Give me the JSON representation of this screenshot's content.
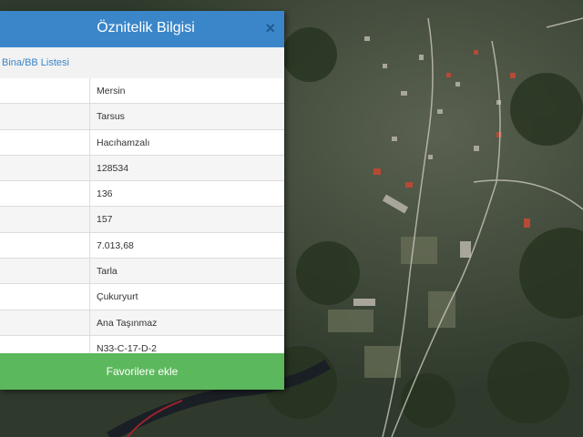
{
  "dialog": {
    "title": "Öznitelik Bilgisi",
    "close_icon": "×",
    "subheader_link": "Bina/BB Listesi",
    "rows": [
      {
        "value": "Mersin"
      },
      {
        "value": "Tarsus"
      },
      {
        "value": "Hacıhamzalı"
      },
      {
        "value": "128534"
      },
      {
        "value": "136"
      },
      {
        "value": "157"
      },
      {
        "value": "7.013,68"
      },
      {
        "value": "Tarla"
      },
      {
        "value": "Çukuryurt"
      },
      {
        "value": "Ana Taşınmaz"
      },
      {
        "value": "N33-C-17-D-2"
      }
    ],
    "favorite_button": "Favorilere ekle"
  },
  "colors": {
    "header": "#3a86c8",
    "favorite_button": "#5cb85c"
  }
}
